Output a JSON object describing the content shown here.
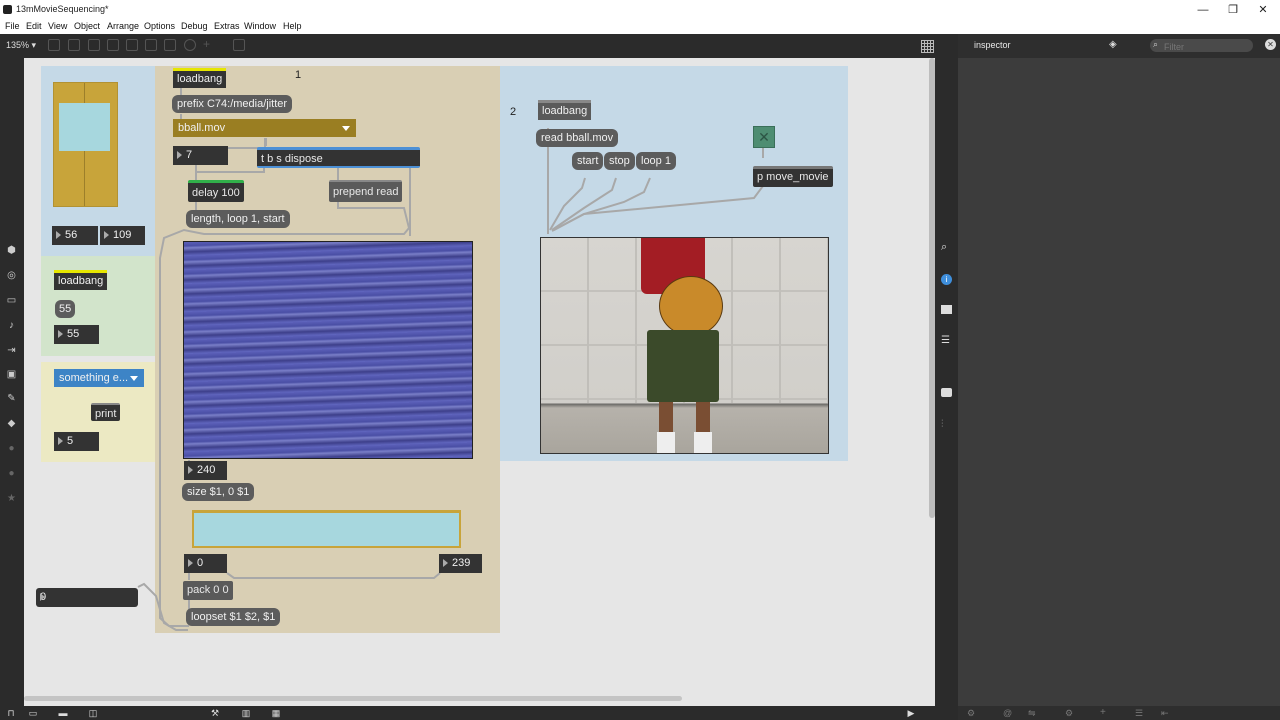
{
  "window": {
    "title": "13mMovieSequencing*",
    "minimize": "—",
    "restore": "❐",
    "close": "✕"
  },
  "menu": [
    "File",
    "Edit",
    "View",
    "Object",
    "Arrange",
    "Options",
    "Debug",
    "Extras",
    "Window",
    "Help"
  ],
  "toolbar": {
    "zoom": "135% ▾"
  },
  "inspector": {
    "title": "inspector",
    "filter_placeholder": "Filter"
  },
  "patch": {
    "section_labels": {
      "one": "1",
      "two": "2"
    },
    "left_top": {
      "num_a": "56",
      "num_b": "109"
    },
    "left_mid": {
      "loadbang": "loadbang",
      "msg": "55",
      "num": "55"
    },
    "left_bottom": {
      "umenu": "something e...",
      "print": "print",
      "num": "5"
    },
    "bottom_left_number": "0",
    "center": {
      "loadbang": "loadbang",
      "prefix": "prefix C74:/media/jitter",
      "umenu": "bball.mov",
      "num_count": "7",
      "trigger": "t b s dispose",
      "delay": "delay 100",
      "prepend": "prepend read",
      "length_msg": "length, loop 1, start",
      "num_240": "240",
      "size_msg": "size $1, 0 $1",
      "num_0": "0",
      "num_239": "239",
      "pack": "pack 0 0",
      "loopset": "loopset $1 $2, $1"
    },
    "right": {
      "loadbang": "loadbang",
      "read": "read bball.mov",
      "start": "start",
      "stop": "stop",
      "loop": "loop 1",
      "subpatch": "p move_movie"
    }
  },
  "colors": {
    "panel_blue": "#c5d9e7",
    "panel_tan": "#d9cfb4",
    "panel_green": "#d2e4cb",
    "panel_yellow": "#ece9c3",
    "accent_yellow": "#e6e600"
  }
}
